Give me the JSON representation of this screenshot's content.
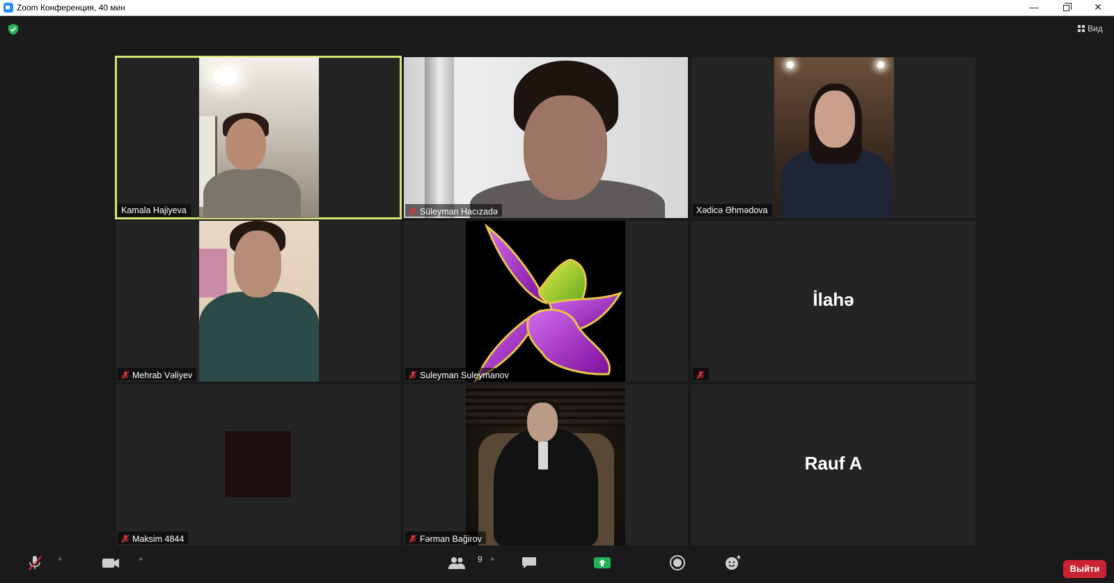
{
  "window": {
    "title": "Zoom Конференция, 40 мин",
    "minimize": "—",
    "close": "✕"
  },
  "view_button": {
    "label": "Вид"
  },
  "participants": [
    {
      "name": "Kamala Hajiyeva",
      "muted": false,
      "active_speaker": true,
      "video": "camera"
    },
    {
      "name": "Süleyman Hacızadə",
      "muted": true,
      "active_speaker": false,
      "video": "camera"
    },
    {
      "name": "Xədicə Əhmədova",
      "muted": false,
      "active_speaker": false,
      "video": "camera"
    },
    {
      "name": "Mehrab Vəliyev",
      "muted": true,
      "active_speaker": false,
      "video": "camera"
    },
    {
      "name": "Suleyman Suleymanov",
      "muted": true,
      "active_speaker": false,
      "video": "profile-image"
    },
    {
      "display_name": "İlahə",
      "muted": true,
      "active_speaker": false,
      "video": "off"
    },
    {
      "name": "Maksim 4844",
      "muted": true,
      "active_speaker": false,
      "video": "camera-dark"
    },
    {
      "name": "Fərman Bağirov",
      "muted": true,
      "active_speaker": false,
      "video": "profile-image"
    },
    {
      "display_name": "Rauf A",
      "muted": false,
      "active_speaker": false,
      "video": "off"
    }
  ],
  "toolbar": {
    "participants_count": "9",
    "leave_label": "Выйти",
    "caret": "^"
  },
  "colors": {
    "active_speaker_border": "#d6e36f",
    "leave_button": "#c92233",
    "share_button": "#23b35a",
    "muted_icon": "#e0313f",
    "security_shield": "#23b35a"
  }
}
